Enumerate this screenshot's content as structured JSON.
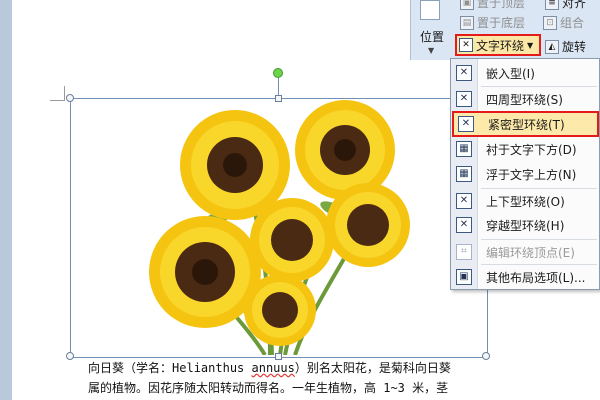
{
  "ribbon": {
    "position_label": "位置",
    "bring_forward": "置于顶层",
    "send_backward": "置于底层",
    "align": "对齐",
    "group": "组合",
    "text_wrap": "文字环绕",
    "rotate": "旋转",
    "icons": {
      "position": "position-icon",
      "bring_forward": "bring-forward-icon",
      "send_backward": "send-backward-icon",
      "align": "align-icon",
      "group": "group-icon",
      "text_wrap": "text-wrap-icon",
      "rotate": "rotate-icon"
    }
  },
  "wrap_menu": {
    "items": [
      {
        "label": "嵌入型(I)",
        "icon": "wrap-inline-icon",
        "enabled": true,
        "highlighted": false
      },
      {
        "label": "四周型环绕(S)",
        "icon": "wrap-square-icon",
        "enabled": true,
        "highlighted": false
      },
      {
        "label": "紧密型环绕(T)",
        "icon": "wrap-tight-icon",
        "enabled": true,
        "highlighted": true
      },
      {
        "label": "衬于文字下方(D)",
        "icon": "wrap-behind-icon",
        "enabled": true,
        "highlighted": false
      },
      {
        "label": "浮于文字上方(N)",
        "icon": "wrap-front-icon",
        "enabled": true,
        "highlighted": false
      },
      {
        "label": "上下型环绕(O)",
        "icon": "wrap-topbottom-icon",
        "enabled": true,
        "highlighted": false
      },
      {
        "label": "穿越型环绕(H)",
        "icon": "wrap-through-icon",
        "enabled": true,
        "highlighted": false
      },
      {
        "label": "编辑环绕顶点(E)",
        "icon": "edit-wrap-points-icon",
        "enabled": false,
        "highlighted": false
      },
      {
        "label": "其他布局选项(L)...",
        "icon": "more-layout-icon",
        "enabled": true,
        "highlighted": false
      }
    ]
  },
  "document": {
    "line1_before": "向日葵（学名：",
    "line1_latin_a": "Helianthus ",
    "line1_latin_b": "annuus",
    "line1_after": "）别名太阳花，是菊科向日葵",
    "line2": "属的植物。因花序随太阳转动而得名。一年生植物，高 1~3 米，茎"
  },
  "picture": {
    "subject": "sunflowers"
  },
  "colors": {
    "highlight_border": "#e51b1b",
    "menu_highlight": "#fde9a9",
    "selection_frame": "#6f8fb5",
    "rotation_handle": "#6fd24b"
  }
}
